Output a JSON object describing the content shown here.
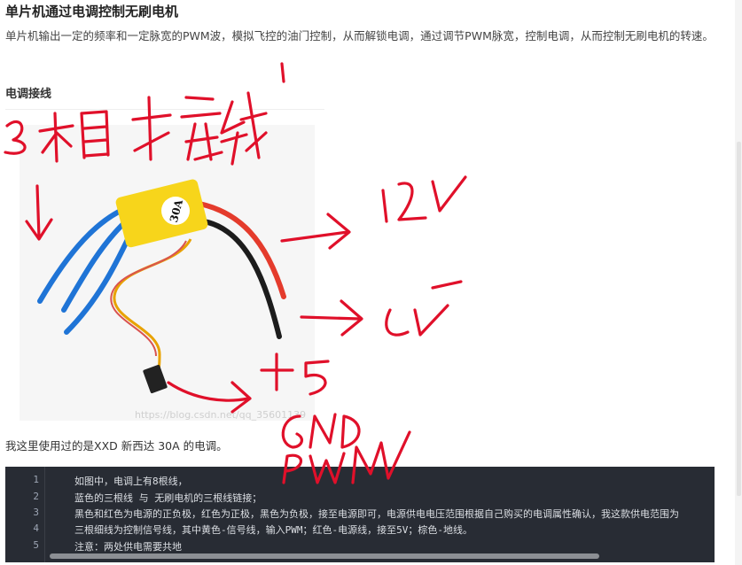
{
  "article": {
    "title": "单片机通过电调控制无刷电机",
    "intro": "单片机输出一定的频率和一定脉宽的PWM波，模拟飞控的油门控制，从而解锁电调，通过调节PWM脉宽，控制电调，从而控制无刷电机的转速。",
    "section_heading": "电调接线",
    "image_label": "30A",
    "image_watermark": "https://blog.csdn.net/qq_35601139",
    "caption": "我这里使用过的是XXD 新西达 30A 的电调。"
  },
  "code": {
    "line_numbers": [
      "1",
      "2",
      "3",
      "4",
      "5"
    ],
    "lines": [
      "如图中，电调上有8根线，",
      "蓝色的三根线 与 无刷电机的三根线链接；",
      "黑色和红色为电源的正负极，红色为正极，黑色为负极，接至电源即可，电源供电电压范围根据自己购买的电调属性确认，我这款供电范围为",
      "三根细线为控制信号线，其中黄色-信号线，输入PWM；红色-电源线，接至5V；棕色-地线。",
      "注意：两处供电需要共地"
    ]
  },
  "colors": {
    "annotation": "#e0102a",
    "code_bg": "#282c34",
    "esc_body": "#f7d51b",
    "wire_blue": "#1f74d6",
    "wire_red": "#e43b2c",
    "wire_black": "#1c1c1c"
  }
}
